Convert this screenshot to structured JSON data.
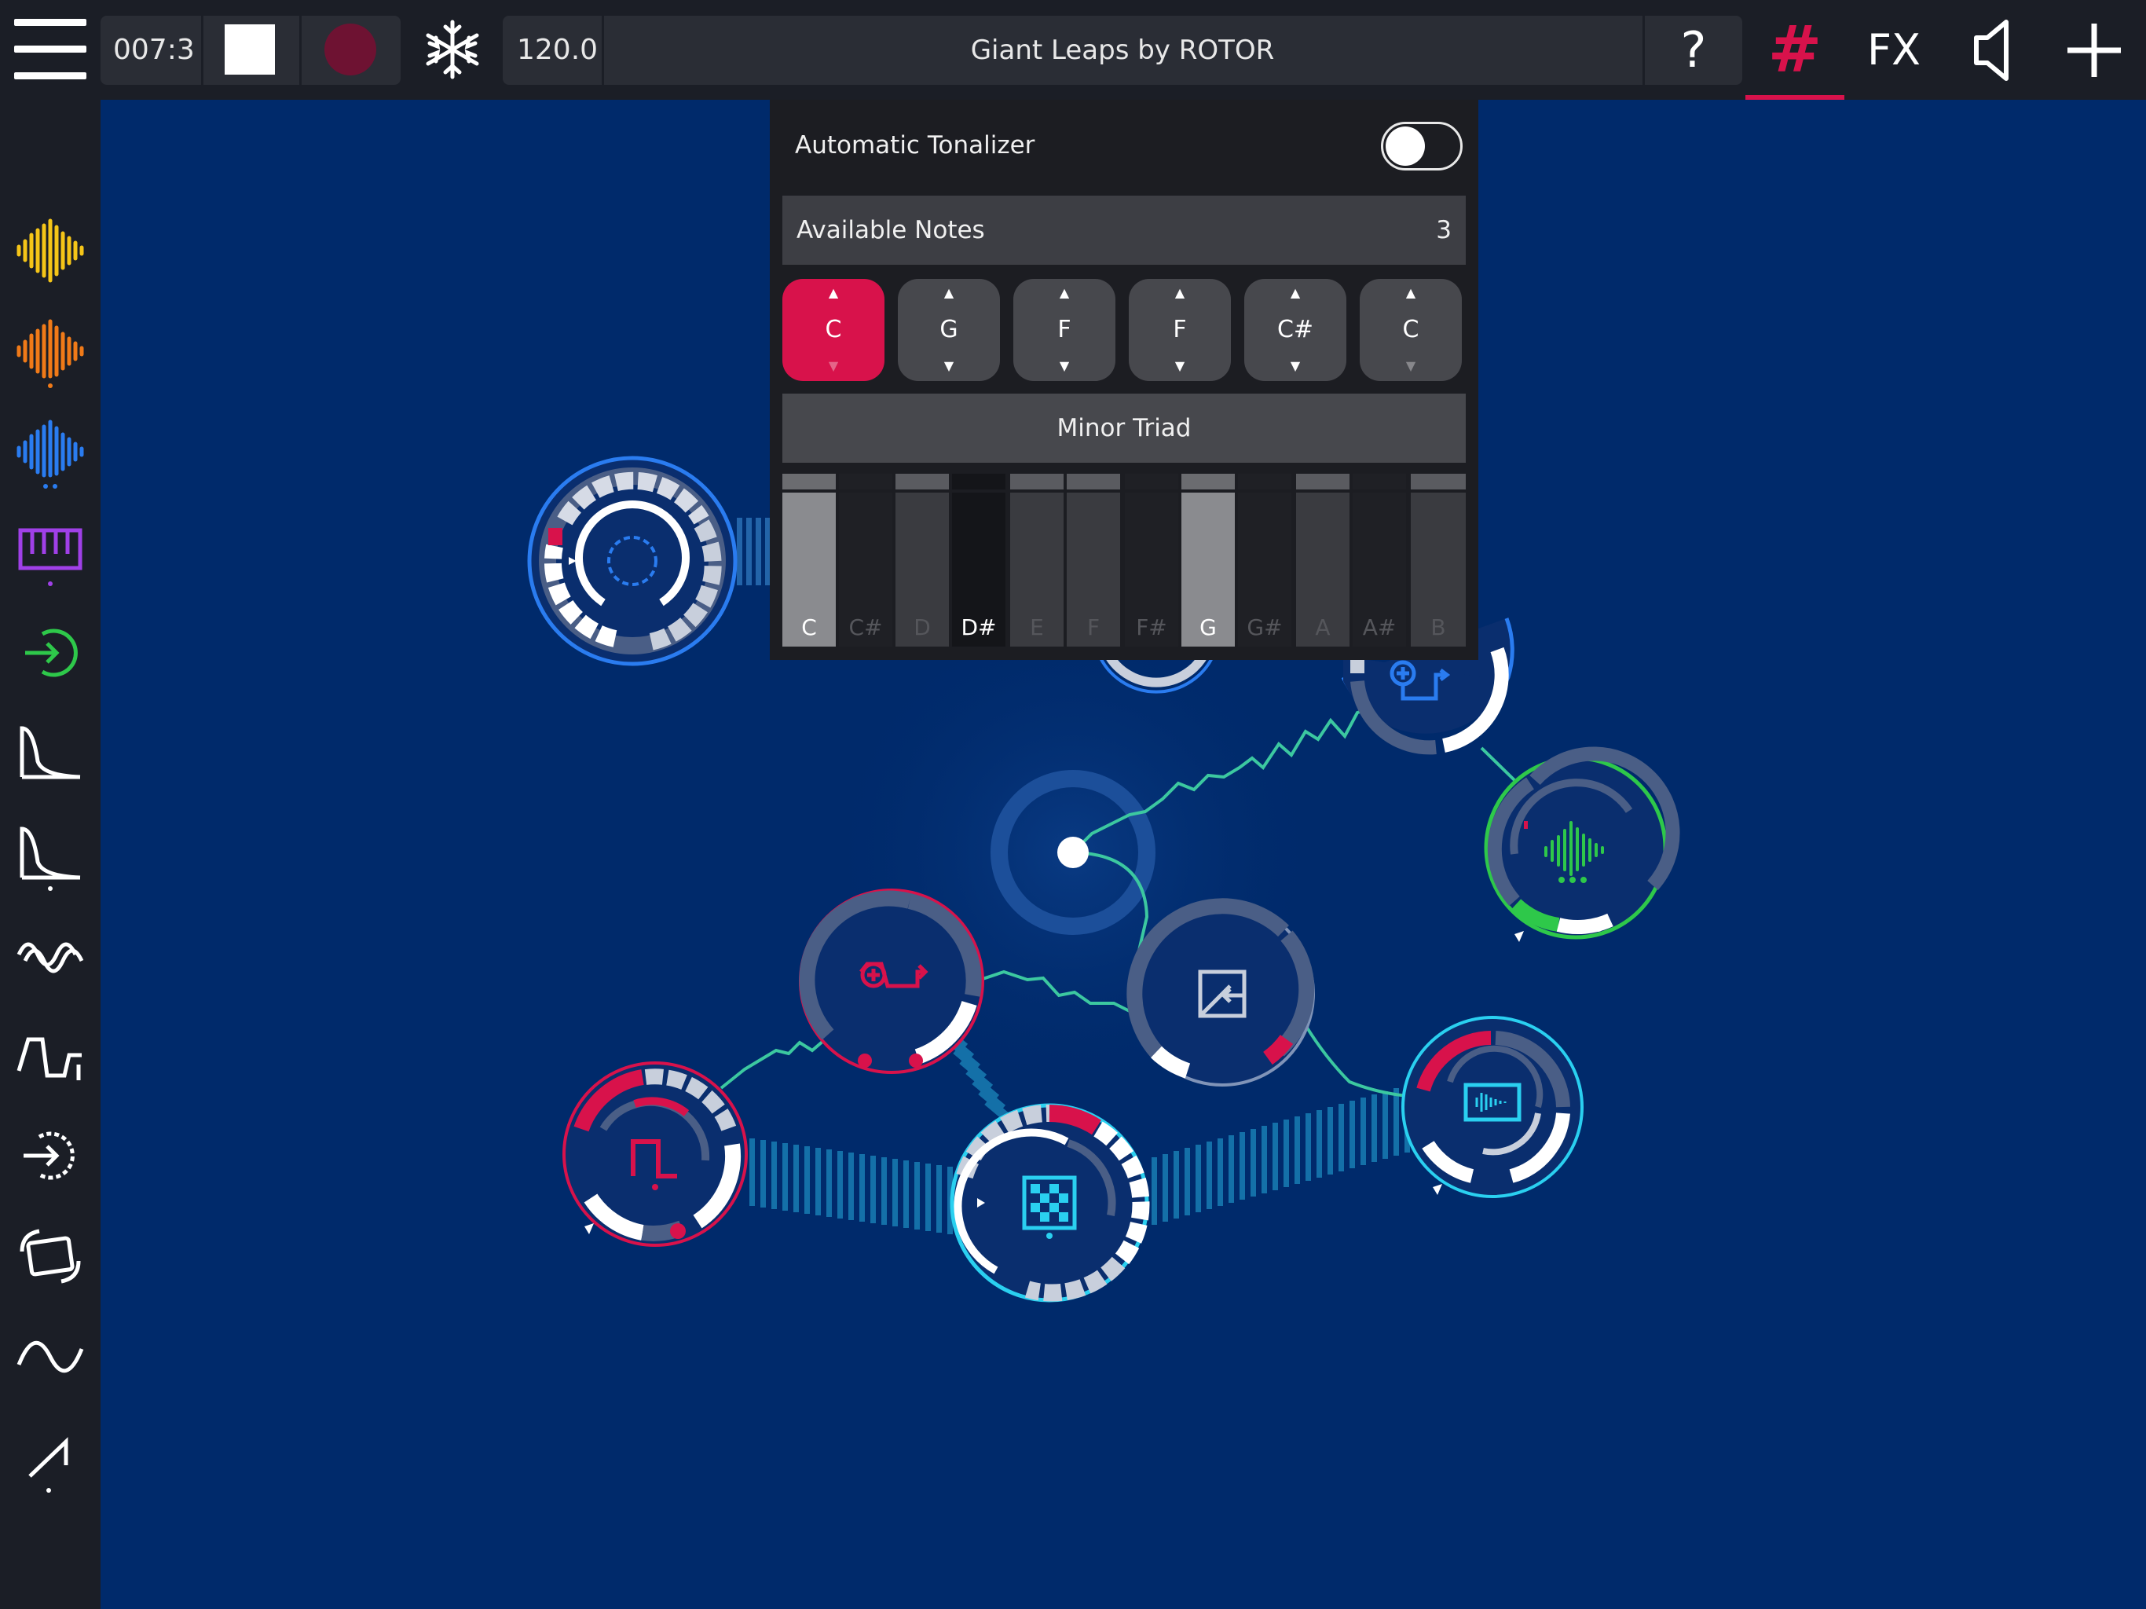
{
  "topbar": {
    "position": "007:3",
    "tempo": "120.0",
    "song_title": "Giant Leaps by ROTOR",
    "help_label": "?",
    "tonalizer_tab_label": "#",
    "fx_label": "FX",
    "accent_color": "#d8124b"
  },
  "sidebar": {
    "icons": [
      "sample-yellow-icon",
      "sample-orange-icon",
      "sample-blue-icon",
      "keyboard-icon",
      "audio-input-icon",
      "envelope-icon",
      "envelope-trigger-icon",
      "lfo-wave-icon",
      "step-sequencer-icon",
      "midi-input-icon",
      "device-motion-icon",
      "sine-lfo-icon",
      "ramp-icon"
    ]
  },
  "tonalizer": {
    "automatic_label": "Automatic Tonalizer",
    "automatic_enabled": false,
    "available_notes_label": "Available Notes",
    "available_notes_count": "3",
    "notes": [
      {
        "name": "C",
        "active": true,
        "up": "▲",
        "down": "▼"
      },
      {
        "name": "G",
        "active": false,
        "up": "▲",
        "down": "▼"
      },
      {
        "name": "F",
        "active": false,
        "up": "▲",
        "down": "▼"
      },
      {
        "name": "F",
        "active": false,
        "up": "▲",
        "down": "▼"
      },
      {
        "name": "C#",
        "active": false,
        "up": "▲",
        "down": "▼"
      },
      {
        "name": "C",
        "active": false,
        "up": "▲",
        "down": "▼"
      }
    ],
    "scale_label": "Minor Triad",
    "keys": [
      {
        "label": "C",
        "state": "on"
      },
      {
        "label": "C#",
        "state": "black"
      },
      {
        "label": "D",
        "state": "off"
      },
      {
        "label": "D#",
        "state": "black-on"
      },
      {
        "label": "E",
        "state": "off"
      },
      {
        "label": "F",
        "state": "off"
      },
      {
        "label": "F#",
        "state": "black"
      },
      {
        "label": "G",
        "state": "on"
      },
      {
        "label": "G#",
        "state": "black"
      },
      {
        "label": "A",
        "state": "off"
      },
      {
        "label": "A#",
        "state": "black"
      },
      {
        "label": "B",
        "state": "off"
      }
    ]
  },
  "colors": {
    "canvas_bg": "#002a6b",
    "patch_line": "#3cc8a0",
    "red": "#d8124b",
    "blue": "#2a7cf0",
    "green": "#2ec84a",
    "cyan": "#2ad0f0"
  }
}
